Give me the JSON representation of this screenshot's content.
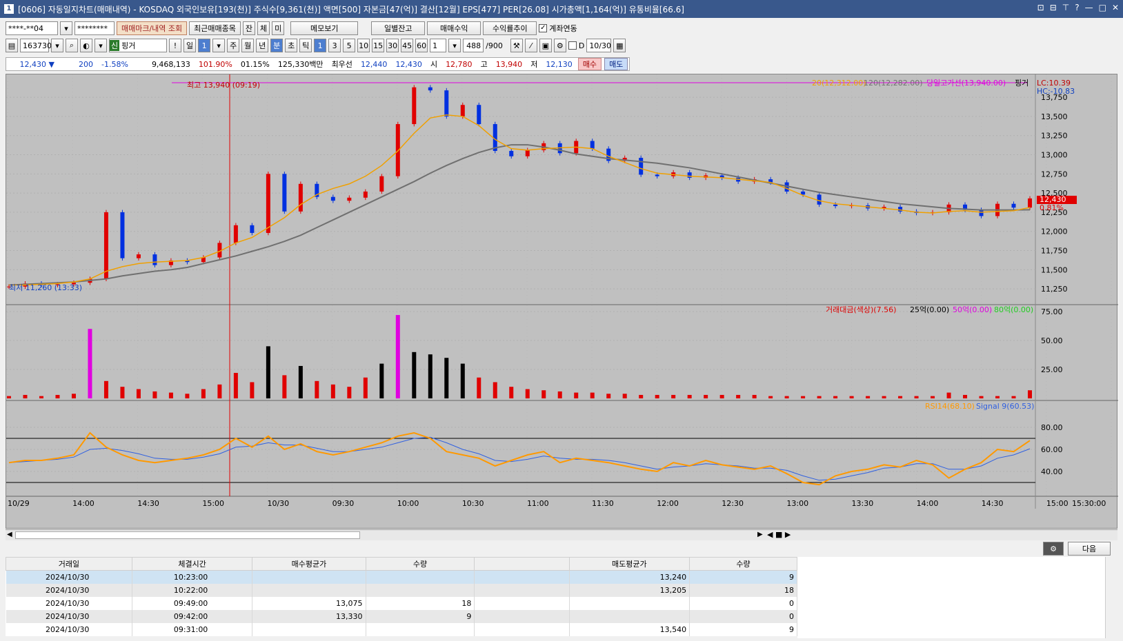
{
  "window": {
    "title": "[0606] 자동일지차트(매매내역) - KOSDAQ 외국인보유[193(천)] 주식수[9,361(천)] 액면[500] 자본금[47(억)] 결산[12월] EPS[477] PER[26.08] 시가총액[1,164(억)] 유통비율[66.6]",
    "icon_label": "1",
    "buttons": [
      "⊡",
      "⊟",
      "⊤",
      "?",
      "—",
      "□",
      "✕"
    ]
  },
  "toolbar1": {
    "account": "****-**04",
    "password": "********",
    "trade_mark_btn": "매매마크/내역 조회",
    "recent_btn": "최근매매종목",
    "jan_btn": "잔",
    "che_btn": "체",
    "mi_btn": "미",
    "memo_btn": "메모보기",
    "daily_btn": "일별잔고",
    "profit_btn": "매매수익",
    "rate_btn": "수익률추이",
    "link_label": "계좌연동"
  },
  "toolbar2": {
    "code": "163730",
    "new_badge": "신",
    "name": "핑거",
    "excl": "!",
    "day": "일",
    "period_val": "1",
    "periods": [
      "주",
      "월",
      "년",
      "분",
      "초",
      "틱"
    ],
    "mins": [
      "1",
      "3",
      "5",
      "10",
      "15",
      "30",
      "45",
      "60"
    ],
    "interval": "1",
    "count": "488",
    "count_total": "/900",
    "d_label": "D",
    "date": "10/30"
  },
  "quote": {
    "price": "12,430",
    "arrow": "▼",
    "change": "200",
    "pct": "-1.58%",
    "volume": "9,468,133",
    "vol_ratio": "101.90%",
    "turnover": "01.15%",
    "amount": "125,330백만",
    "best_label": "최우선",
    "best_sell": "12,440",
    "best_buy": "12,430",
    "open_label": "시",
    "open": "12,780",
    "high_label": "고",
    "high": "13,940",
    "low_label": "저",
    "low": "12,130",
    "buy_btn": "매수",
    "sell_btn": "매도"
  },
  "chart": {
    "legend_ma20": "20(12,312.00)",
    "legend_ma120": "120(12,282.00)",
    "legend_high": "당일고가선(13,940.00)",
    "legend_name": "핑거",
    "lc": "LC:10.39",
    "hc": "HC:-10.83",
    "high_note": "최고 13,940 (09:19)",
    "low_note": "최저 11,260 (13:33)",
    "last_price": "12,430",
    "last_pct": "0.81%",
    "vol_legend": "거래대금(색상)(7.56)",
    "vol_l1": "25억(0.00)",
    "vol_l2": "50억(0.00)",
    "vol_l3": "80억(0.00)",
    "rsi_legend": "RSI14(68.10)",
    "sig_legend": "Signal 9(60.53)",
    "colors": {
      "up": "#e00000",
      "down": "#0030e0",
      "ma20": "#f0a000",
      "ma120": "#707070",
      "high_line": "#e000e0",
      "rsi": "#ff9900",
      "signal": "#3060e0"
    }
  },
  "chart_data": {
    "type": "line",
    "price_axis_ticks": [
      "13,750",
      "13,500",
      "13,250",
      "13,000",
      "12,750",
      "12,500",
      "12,250",
      "12,000",
      "11,750",
      "11,500",
      "11,250"
    ],
    "vol_axis_ticks": [
      "75.00",
      "50.00",
      "25.00"
    ],
    "rsi_axis_ticks": [
      "80.00",
      "60.00",
      "40.00"
    ],
    "time_labels": [
      "10/29",
      "14:00",
      "14:30",
      "15:00",
      "10/30",
      "09:30",
      "10:00",
      "10:30",
      "11:00",
      "11:30",
      "12:00",
      "12:30",
      "13:00",
      "13:30",
      "14:00",
      "14:30",
      "15:00",
      "15:30:00"
    ],
    "price_series": [
      11280,
      11320,
      11300,
      11310,
      11330,
      11380,
      12250,
      11650,
      11700,
      11560,
      11620,
      11600,
      11660,
      11850,
      12080,
      11980,
      12750,
      12260,
      12620,
      12450,
      12400,
      12440,
      12520,
      12720,
      13400,
      13880,
      13840,
      13500,
      13650,
      13400,
      13050,
      12980,
      13060,
      13150,
      13020,
      13180,
      13080,
      12920,
      12960,
      12740,
      12720,
      12770,
      12700,
      12730,
      12700,
      12650,
      12680,
      12640,
      12520,
      12480,
      12350,
      12330,
      12340,
      12300,
      12320,
      12260,
      12240,
      12250,
      12350,
      12280,
      12200,
      12360,
      12310,
      12430
    ],
    "ma20": [
      11300,
      11300,
      11310,
      11320,
      11340,
      11380,
      11480,
      11540,
      11580,
      11600,
      11610,
      11620,
      11660,
      11740,
      11850,
      11920,
      12050,
      12180,
      12350,
      12480,
      12560,
      12620,
      12720,
      12860,
      13050,
      13280,
      13480,
      13520,
      13500,
      13380,
      13200,
      13080,
      13060,
      13080,
      13090,
      13100,
      13080,
      12980,
      12900,
      12820,
      12760,
      12740,
      12720,
      12710,
      12700,
      12680,
      12660,
      12640,
      12560,
      12470,
      12400,
      12360,
      12340,
      12320,
      12300,
      12280,
      12250,
      12240,
      12260,
      12270,
      12250,
      12260,
      12270,
      12312
    ],
    "ma120": [
      11300,
      11310,
      11320,
      11330,
      11340,
      11360,
      11380,
      11420,
      11450,
      11480,
      11500,
      11530,
      11580,
      11630,
      11680,
      11740,
      11800,
      11870,
      11950,
      12050,
      12150,
      12250,
      12350,
      12450,
      12550,
      12650,
      12760,
      12860,
      12950,
      13030,
      13090,
      13130,
      13130,
      13100,
      13060,
      13010,
      12980,
      12950,
      12930,
      12910,
      12890,
      12860,
      12830,
      12790,
      12750,
      12710,
      12670,
      12630,
      12590,
      12550,
      12510,
      12480,
      12450,
      12420,
      12390,
      12360,
      12340,
      12320,
      12300,
      12290,
      12280,
      12280,
      12280,
      12282
    ],
    "volume": [
      2,
      3,
      2,
      3,
      4,
      60,
      15,
      10,
      8,
      6,
      5,
      4,
      8,
      12,
      22,
      14,
      45,
      20,
      28,
      15,
      12,
      10,
      18,
      30,
      72,
      40,
      38,
      35,
      30,
      18,
      14,
      10,
      8,
      7,
      6,
      5,
      5,
      4,
      4,
      3,
      3,
      3,
      3,
      3,
      3,
      3,
      3,
      2,
      2,
      2,
      2,
      2,
      2,
      2,
      2,
      2,
      2,
      2,
      5,
      3,
      2,
      2,
      2,
      7
    ],
    "rsi": [
      48,
      50,
      50,
      52,
      55,
      75,
      62,
      55,
      50,
      48,
      50,
      52,
      55,
      60,
      70,
      62,
      72,
      60,
      65,
      58,
      55,
      58,
      62,
      66,
      72,
      75,
      70,
      58,
      55,
      52,
      45,
      50,
      55,
      58,
      48,
      52,
      50,
      48,
      45,
      42,
      40,
      48,
      45,
      50,
      46,
      44,
      42,
      45,
      38,
      30,
      28,
      36,
      40,
      42,
      46,
      44,
      50,
      46,
      34,
      42,
      48,
      60,
      58,
      68
    ],
    "signal": [
      48,
      49,
      50,
      51,
      53,
      60,
      61,
      59,
      56,
      52,
      51,
      51,
      53,
      56,
      62,
      63,
      66,
      64,
      64,
      61,
      58,
      58,
      60,
      62,
      66,
      70,
      71,
      66,
      60,
      56,
      50,
      49,
      51,
      54,
      52,
      51,
      51,
      50,
      48,
      45,
      42,
      44,
      45,
      47,
      46,
      45,
      43,
      43,
      41,
      36,
      32,
      33,
      36,
      39,
      43,
      44,
      47,
      47,
      42,
      42,
      45,
      52,
      55,
      60.53
    ]
  },
  "trades": {
    "headers": [
      "거래일",
      "체결시간",
      "매수평균가",
      "수량",
      "",
      "매도평균가",
      "수량"
    ],
    "rows": [
      {
        "date": "2024/10/30",
        "time": "10:23:00",
        "buy_px": "",
        "buy_qty": "",
        "sell_px": "13,240",
        "sell_qty": "9"
      },
      {
        "date": "2024/10/30",
        "time": "10:22:00",
        "buy_px": "",
        "buy_qty": "",
        "sell_px": "13,205",
        "sell_qty": "18"
      },
      {
        "date": "2024/10/30",
        "time": "09:49:00",
        "buy_px": "13,075",
        "buy_qty": "18",
        "sell_px": "",
        "sell_qty": "0"
      },
      {
        "date": "2024/10/30",
        "time": "09:42:00",
        "buy_px": "13,330",
        "buy_qty": "9",
        "sell_px": "",
        "sell_qty": "0"
      },
      {
        "date": "2024/10/30",
        "time": "09:31:00",
        "buy_px": "",
        "buy_qty": "",
        "sell_px": "13,540",
        "sell_qty": "9"
      }
    ],
    "next_btn": "다음"
  }
}
